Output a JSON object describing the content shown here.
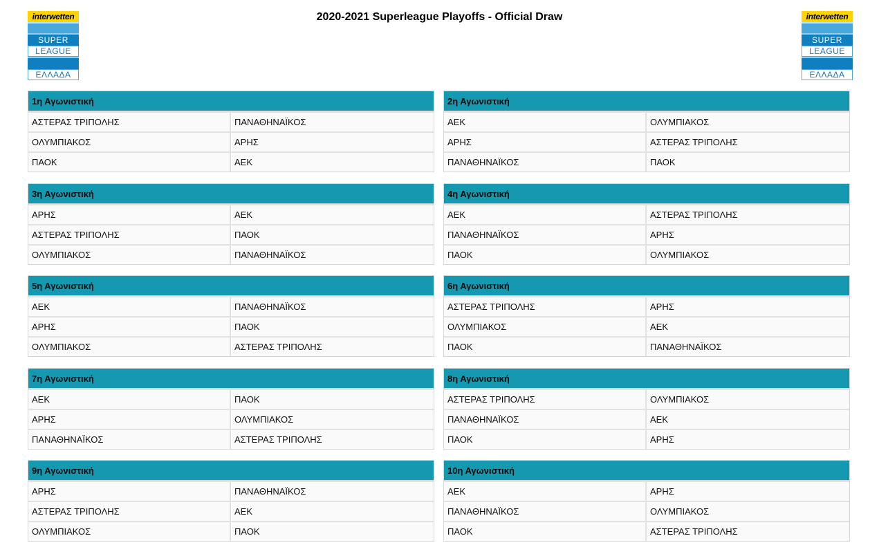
{
  "title": "2020-2021 Superleague Playoffs - Official Draw",
  "logo": {
    "brand": "interwetten",
    "line1": "SUPER",
    "line2": "LEAGUE",
    "line3": "ΕΛΛΑΔΑ"
  },
  "colors": {
    "header_bg": "#1599b1",
    "row_bg": "#fafafa",
    "border": "#d6d6d6"
  },
  "rounds": [
    {
      "label": "1η Αγωνιστική",
      "matches": [
        {
          "home": "ΑΣΤΕΡΑΣ ΤΡΙΠΟΛΗΣ",
          "away": "ΠΑΝΑΘΗΝΑΪΚΟΣ"
        },
        {
          "home": "ΟΛΥΜΠΙΑΚΟΣ",
          "away": "ΑΡΗΣ"
        },
        {
          "home": "ΠΑΟΚ",
          "away": "ΑΕΚ"
        }
      ]
    },
    {
      "label": "2η Αγωνιστική",
      "matches": [
        {
          "home": "ΑΕΚ",
          "away": "ΟΛΥΜΠΙΑΚΟΣ"
        },
        {
          "home": "ΑΡΗΣ",
          "away": "ΑΣΤΕΡΑΣ ΤΡΙΠΟΛΗΣ"
        },
        {
          "home": "ΠΑΝΑΘΗΝΑΪΚΟΣ",
          "away": "ΠΑΟΚ"
        }
      ]
    },
    {
      "label": "3η Αγωνιστική",
      "matches": [
        {
          "home": "ΑΡΗΣ",
          "away": "ΑΕΚ"
        },
        {
          "home": "ΑΣΤΕΡΑΣ ΤΡΙΠΟΛΗΣ",
          "away": "ΠΑΟΚ"
        },
        {
          "home": "ΟΛΥΜΠΙΑΚΟΣ",
          "away": "ΠΑΝΑΘΗΝΑΪΚΟΣ"
        }
      ]
    },
    {
      "label": "4η Αγωνιστική",
      "matches": [
        {
          "home": "ΑΕΚ",
          "away": "ΑΣΤΕΡΑΣ ΤΡΙΠΟΛΗΣ"
        },
        {
          "home": "ΠΑΝΑΘΗΝΑΪΚΟΣ",
          "away": "ΑΡΗΣ"
        },
        {
          "home": "ΠΑΟΚ",
          "away": "ΟΛΥΜΠΙΑΚΟΣ"
        }
      ]
    },
    {
      "label": "5η Αγωνιστική",
      "matches": [
        {
          "home": "ΑΕΚ",
          "away": "ΠΑΝΑΘΗΝΑΪΚΟΣ"
        },
        {
          "home": "ΑΡΗΣ",
          "away": "ΠΑΟΚ"
        },
        {
          "home": "ΟΛΥΜΠΙΑΚΟΣ",
          "away": "ΑΣΤΕΡΑΣ ΤΡΙΠΟΛΗΣ"
        }
      ]
    },
    {
      "label": "6η Αγωνιστική",
      "matches": [
        {
          "home": "ΑΣΤΕΡΑΣ ΤΡΙΠΟΛΗΣ",
          "away": "ΑΡΗΣ"
        },
        {
          "home": "ΟΛΥΜΠΙΑΚΟΣ",
          "away": "ΑΕΚ"
        },
        {
          "home": "ΠΑΟΚ",
          "away": "ΠΑΝΑΘΗΝΑΪΚΟΣ"
        }
      ]
    },
    {
      "label": "7η Αγωνιστική",
      "matches": [
        {
          "home": "ΑΕΚ",
          "away": "ΠΑΟΚ"
        },
        {
          "home": "ΑΡΗΣ",
          "away": "ΟΛΥΜΠΙΑΚΟΣ"
        },
        {
          "home": "ΠΑΝΑΘΗΝΑΪΚΟΣ",
          "away": "ΑΣΤΕΡΑΣ ΤΡΙΠΟΛΗΣ"
        }
      ]
    },
    {
      "label": "8η Αγωνιστική",
      "matches": [
        {
          "home": "ΑΣΤΕΡΑΣ ΤΡΙΠΟΛΗΣ",
          "away": "ΟΛΥΜΠΙΑΚΟΣ"
        },
        {
          "home": "ΠΑΝΑΘΗΝΑΪΚΟΣ",
          "away": "ΑΕΚ"
        },
        {
          "home": "ΠΑΟΚ",
          "away": "ΑΡΗΣ"
        }
      ]
    },
    {
      "label": "9η Αγωνιστική",
      "matches": [
        {
          "home": "ΑΡΗΣ",
          "away": "ΠΑΝΑΘΗΝΑΪΚΟΣ"
        },
        {
          "home": "ΑΣΤΕΡΑΣ ΤΡΙΠΟΛΗΣ",
          "away": "ΑΕΚ"
        },
        {
          "home": "ΟΛΥΜΠΙΑΚΟΣ",
          "away": "ΠΑΟΚ"
        }
      ]
    },
    {
      "label": "10η Αγωνιστική",
      "matches": [
        {
          "home": "ΑΕΚ",
          "away": "ΑΡΗΣ"
        },
        {
          "home": "ΠΑΝΑΘΗΝΑΪΚΟΣ",
          "away": "ΟΛΥΜΠΙΑΚΟΣ"
        },
        {
          "home": "ΠΑΟΚ",
          "away": "ΑΣΤΕΡΑΣ ΤΡΙΠΟΛΗΣ"
        }
      ]
    }
  ]
}
